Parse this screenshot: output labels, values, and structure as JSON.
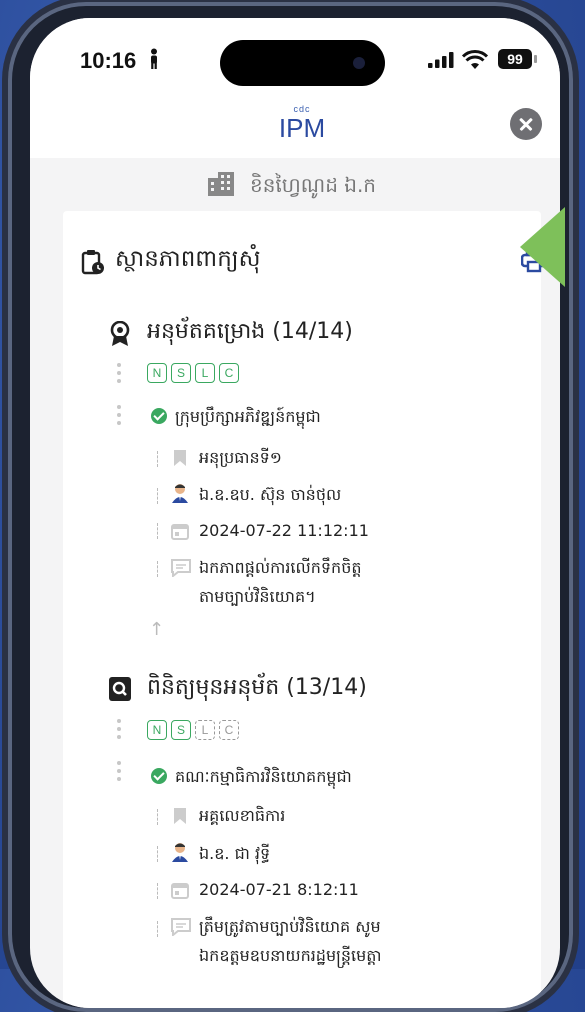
{
  "status": {
    "time": "10:16",
    "battery": "99"
  },
  "header": {
    "logo_sub": "cdc",
    "logo_main": "IPM"
  },
  "company": {
    "name": "ខិនហ្វៃណូដ ឯ.ក"
  },
  "status_section": {
    "title": "ស្ថានភាពពាក្យសុំ"
  },
  "stages": [
    {
      "title": "អនុម័តគម្រោង (14/14)",
      "badges": [
        {
          "label": "N",
          "active": true
        },
        {
          "label": "S",
          "active": true
        },
        {
          "label": "L",
          "active": true
        },
        {
          "label": "C",
          "active": true
        }
      ],
      "org": "ក្រុមប្រឹក្សាអភិវឌ្ឍន៍កម្ពុជា",
      "role": "អនុប្រធានទី១",
      "person": "ឯ.ឧ.ឧប. ស៊ុន ចាន់ថុល",
      "datetime": "2024-07-22 11:12:11",
      "comment_l1": "ឯកភាពផ្ដល់ការលើកទឹកចិត្ត",
      "comment_l2": "តាមច្បាប់វិនិយោគ។"
    },
    {
      "title": "ពិនិត្យមុនអនុម័ត (13/14)",
      "badges": [
        {
          "label": "N",
          "active": true
        },
        {
          "label": "S",
          "active": true
        },
        {
          "label": "L",
          "active": false
        },
        {
          "label": "C",
          "active": false
        }
      ],
      "org": "គណៈកម្មាធិការវិនិយោគកម្ពុជា",
      "role": "អគ្គលេខាធិការ",
      "person": "ឯ.ឧ. ជា វុទ្ធី",
      "datetime": "2024-07-21 8:12:11",
      "comment_l1": "ត្រឹមត្រូវតាមច្បាប់វិនិយោគ សូម",
      "comment_l2": "ឯកឧត្តមឧបនាយករដ្ឋមន្ត្រីមេត្តា"
    }
  ],
  "colors": {
    "accent": "#2b4aa0",
    "success": "#3aa860",
    "pointer": "#7ec05a"
  }
}
